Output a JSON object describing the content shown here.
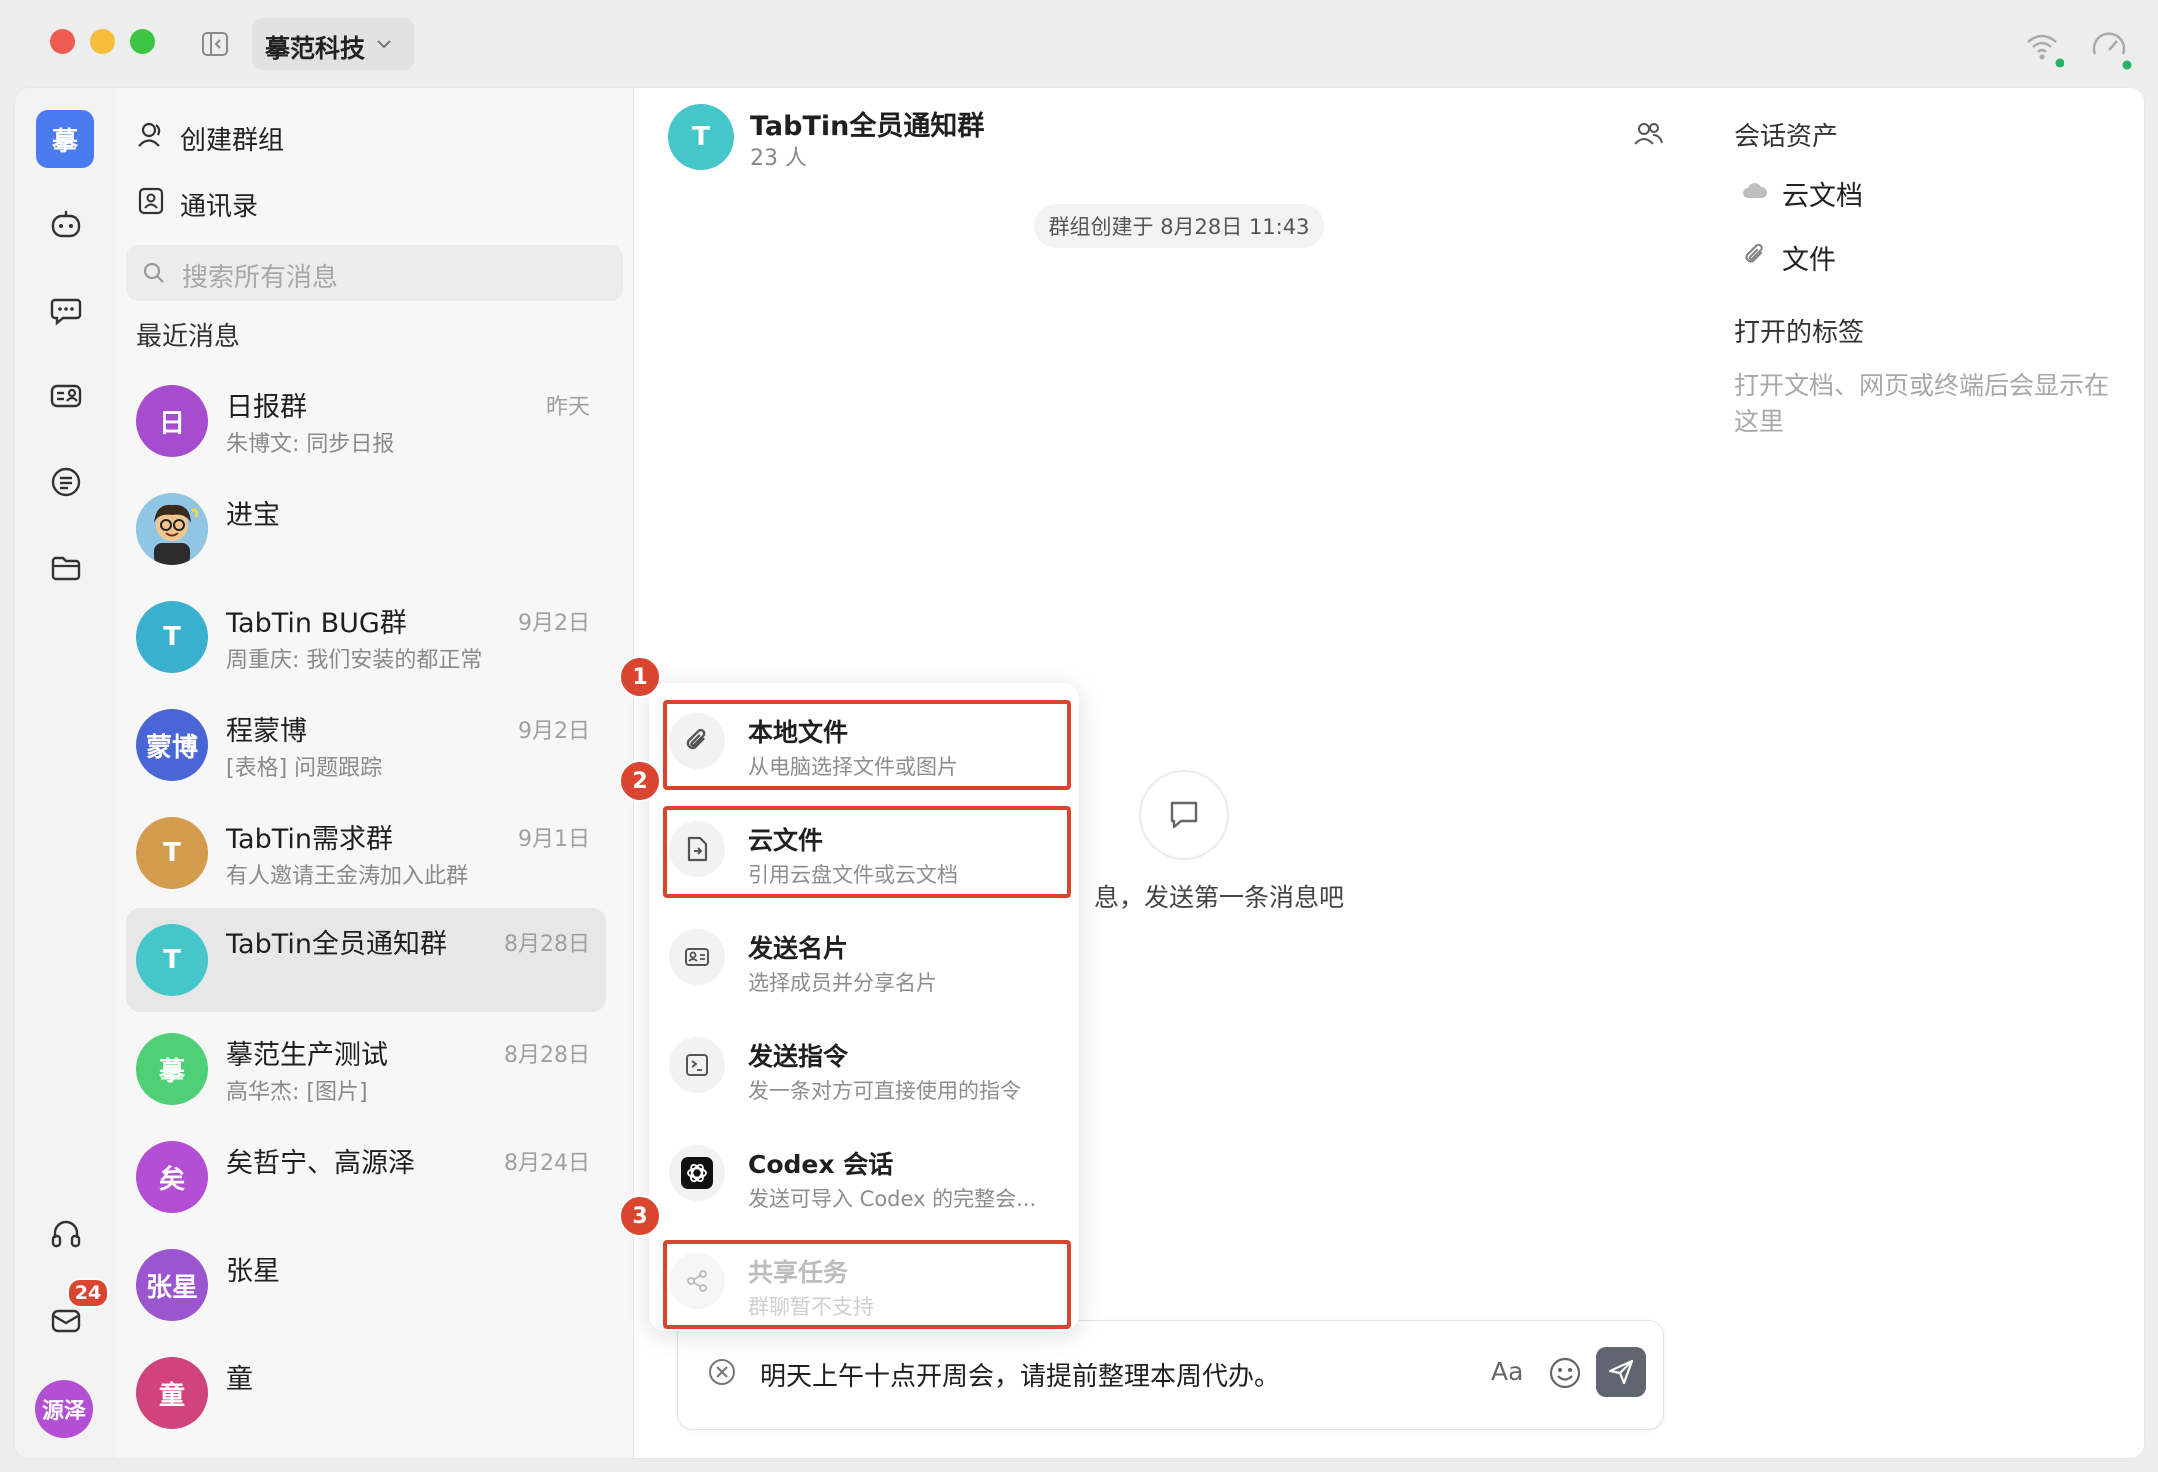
{
  "titlebar": {
    "workspace": "摹范科技"
  },
  "rail": {
    "org_avatar": "摹",
    "mail_badge": "24",
    "user_avatar": "源泽"
  },
  "sidebar": {
    "create_group": "创建群组",
    "contacts": "通讯录",
    "search_placeholder": "搜索所有消息",
    "recent_title": "最近消息",
    "conversations": [
      {
        "avatar": "日",
        "name": "日报群",
        "time": "昨天",
        "preview": "朱博文: 同步日报",
        "color": "#a64ccf"
      },
      {
        "avatar": "",
        "name": "进宝",
        "time": "",
        "preview": "",
        "color": "#e8b84a"
      },
      {
        "avatar": "T",
        "name": "TabTin BUG群",
        "time": "9月2日",
        "preview": "周重庆: 我们安装的都正常",
        "color": "#3ab0cf"
      },
      {
        "avatar": "蒙博",
        "name": "程蒙博",
        "time": "9月2日",
        "preview": "[表格] 问题跟踪",
        "color": "#4a66d6"
      },
      {
        "avatar": "T",
        "name": "TabTin需求群",
        "time": "9月1日",
        "preview": "有人邀请王金涛加入此群",
        "color": "#d39b4e"
      },
      {
        "avatar": "T",
        "name": "TabTin全员通知群",
        "time": "8月28日",
        "preview": "",
        "color": "#45c6c9"
      },
      {
        "avatar": "摹",
        "name": "摹范生产测试",
        "time": "8月28日",
        "preview": "高华杰: [图片]",
        "color": "#4fcf76"
      },
      {
        "avatar": "矣",
        "name": "矣哲宁、高源泽",
        "time": "8月24日",
        "preview": "",
        "color": "#b24fd4"
      },
      {
        "avatar": "张星",
        "name": "张星",
        "time": "",
        "preview": "",
        "color": "#9a55cf"
      },
      {
        "avatar": "童",
        "name": "童",
        "time": "",
        "preview": "",
        "color": "#d0437d"
      }
    ]
  },
  "chat": {
    "group_avatar": "T",
    "group_name": "TabTin全员通知群",
    "member_count": "23 人",
    "system_message": "群组创建于 8月28日 11:43",
    "empty_hint": "息，发送第一条消息吧",
    "input_text": "明天上午十点开周会，请提前整理本周代办。",
    "format_label": "Aa"
  },
  "attach_menu": {
    "items": [
      {
        "title": "本地文件",
        "subtitle": "从电脑选择文件或图片",
        "icon": "paperclip-icon"
      },
      {
        "title": "云文件",
        "subtitle": "引用云盘文件或云文档",
        "icon": "cloud-file-icon"
      },
      {
        "title": "发送名片",
        "subtitle": "选择成员并分享名片",
        "icon": "contact-card-icon"
      },
      {
        "title": "发送指令",
        "subtitle": "发一条对方可直接使用的指令",
        "icon": "terminal-icon"
      },
      {
        "title": "Codex 会话",
        "subtitle": "发送可导入 Codex 的完整会...",
        "icon": "openai-icon"
      },
      {
        "title": "共享任务",
        "subtitle": "群聊暂不支持",
        "icon": "share-icon"
      }
    ],
    "markers": [
      "1",
      "2",
      "3"
    ],
    "highlight_color": "#d9442f"
  },
  "assets": {
    "title": "会话资产",
    "items": [
      "云文档",
      "文件"
    ],
    "tabs_title": "打开的标签",
    "tabs_hint": "打开文档、网页或终端后会显示在这里"
  }
}
